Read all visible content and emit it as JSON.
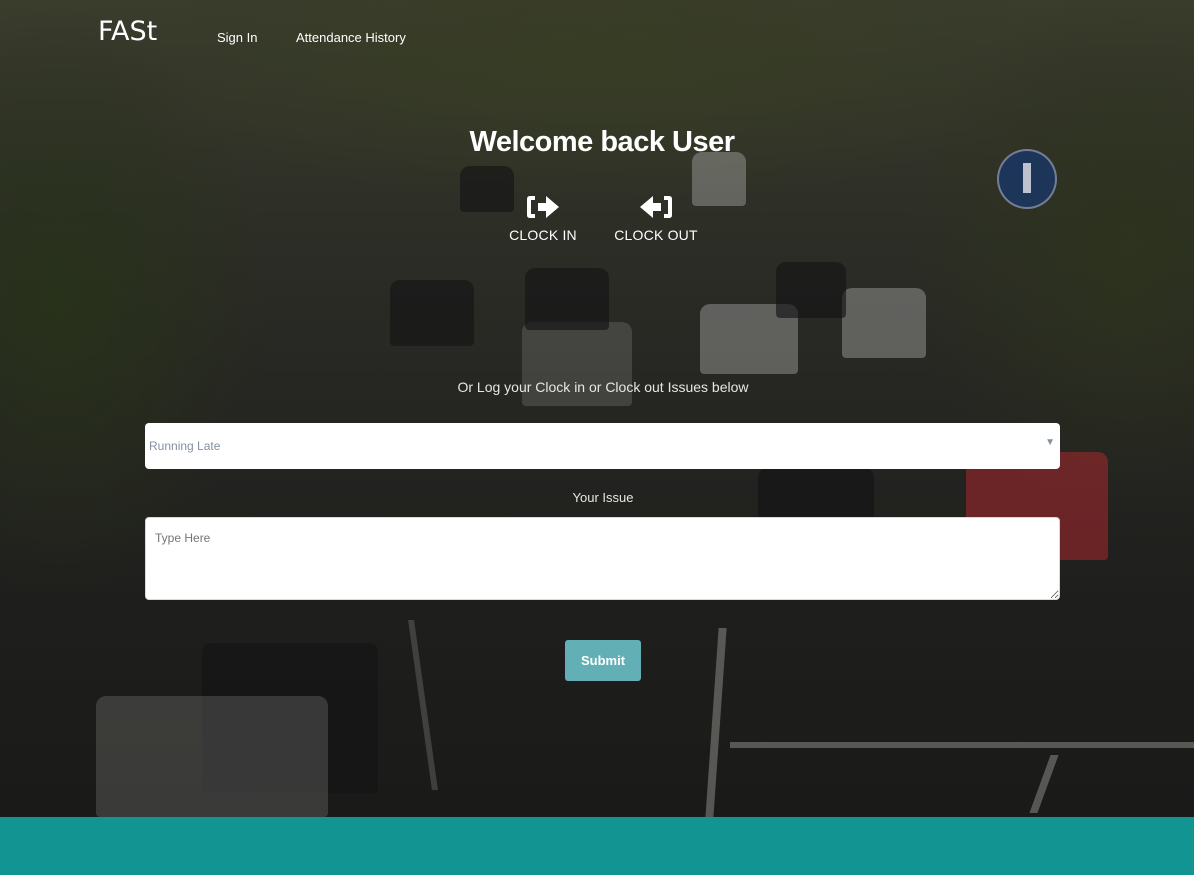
{
  "nav": {
    "brand": "FASt",
    "links": [
      {
        "label": "Sign In"
      },
      {
        "label": "Attendance History"
      }
    ]
  },
  "main": {
    "welcome": "Welcome back User",
    "clock_in": {
      "label": "CLOCK IN",
      "icon": "sign-in-arrow-icon"
    },
    "clock_out": {
      "label": "CLOCK OUT",
      "icon": "sign-out-arrow-icon"
    },
    "subtext": "Or Log your Clock in or Clock out Issues below",
    "issue_select": {
      "selected": "Running Late"
    },
    "issue_label": "Your Issue",
    "issue_textarea": {
      "placeholder": "Type Here",
      "value": ""
    },
    "submit_label": "Submit"
  },
  "colors": {
    "footer": "#129492",
    "submit_button": "#62b0b6",
    "text": "#ffffff"
  }
}
